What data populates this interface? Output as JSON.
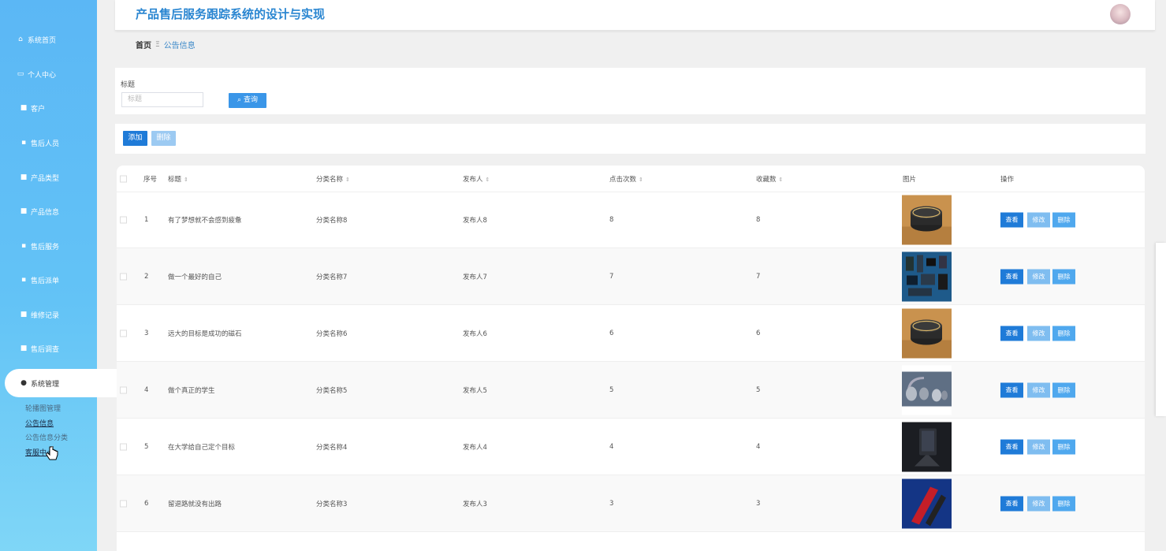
{
  "app": {
    "title": "产品售后服务跟踪系统的设计与实现"
  },
  "sidebar": {
    "items": [
      {
        "label": "系统首页",
        "icon": "home-icon"
      },
      {
        "label": "个人中心",
        "icon": "profile-icon"
      },
      {
        "label": "客户",
        "icon": "grid-icon"
      },
      {
        "label": "售后人员",
        "icon": "grid-icon"
      },
      {
        "label": "产品类型",
        "icon": "grid-icon"
      },
      {
        "label": "产品信息",
        "icon": "grid-icon"
      },
      {
        "label": "售后服务",
        "icon": "grid-icon"
      },
      {
        "label": "售后派单",
        "icon": "grid-icon"
      },
      {
        "label": "维修记录",
        "icon": "grid-icon"
      },
      {
        "label": "售后调查",
        "icon": "grid-icon"
      },
      {
        "label": "系统管理",
        "icon": "user-icon"
      }
    ],
    "subitems": [
      {
        "label": "轮播图管理"
      },
      {
        "label": "公告信息"
      },
      {
        "label": "公告信息分类"
      },
      {
        "label": "客服中心"
      }
    ]
  },
  "breadcrumb": {
    "home": "首页",
    "separator": "Ξ",
    "current": "公告信息"
  },
  "search": {
    "label": "标题",
    "placeholder": "标题",
    "button": "查询"
  },
  "actions": {
    "add": "添加",
    "delete": "删除"
  },
  "table": {
    "headers": {
      "index": "序号",
      "title": "标题",
      "category": "分类名称",
      "publisher": "发布人",
      "clicks": "点击次数",
      "favorites": "收藏数",
      "image": "图片",
      "operation": "操作"
    },
    "row_buttons": {
      "view": "查看",
      "edit": "修改",
      "delete": "删除"
    },
    "rows": [
      {
        "index": "1",
        "title": "有了梦想就不会感到疲惫",
        "category": "分类名称8",
        "publisher": "发布人8",
        "clicks": "8",
        "favorites": "8",
        "image": "speaker-product-image"
      },
      {
        "index": "2",
        "title": "做一个最好的自己",
        "category": "分类名称7",
        "publisher": "发布人7",
        "clicks": "7",
        "favorites": "7",
        "image": "accessories-flatlay-image"
      },
      {
        "index": "3",
        "title": "远大的目标是成功的磁石",
        "category": "分类名称6",
        "publisher": "发布人6",
        "clicks": "6",
        "favorites": "6",
        "image": "speaker-product-image"
      },
      {
        "index": "4",
        "title": "做个真正的学生",
        "category": "分类名称5",
        "publisher": "发布人5",
        "clicks": "5",
        "favorites": "5",
        "image": "headphones-image"
      },
      {
        "index": "5",
        "title": "在大学给自己定个目标",
        "category": "分类名称4",
        "publisher": "发布人4",
        "clicks": "4",
        "favorites": "4",
        "image": "phone-stand-image"
      },
      {
        "index": "6",
        "title": "留退路就没有出路",
        "category": "分类名称3",
        "publisher": "发布人3",
        "clicks": "3",
        "favorites": "3",
        "image": "red-device-image"
      }
    ]
  },
  "colors": {
    "primary": "#1f7bd8",
    "sidebar": "#5bb7f5",
    "title": "#2a86d1"
  }
}
